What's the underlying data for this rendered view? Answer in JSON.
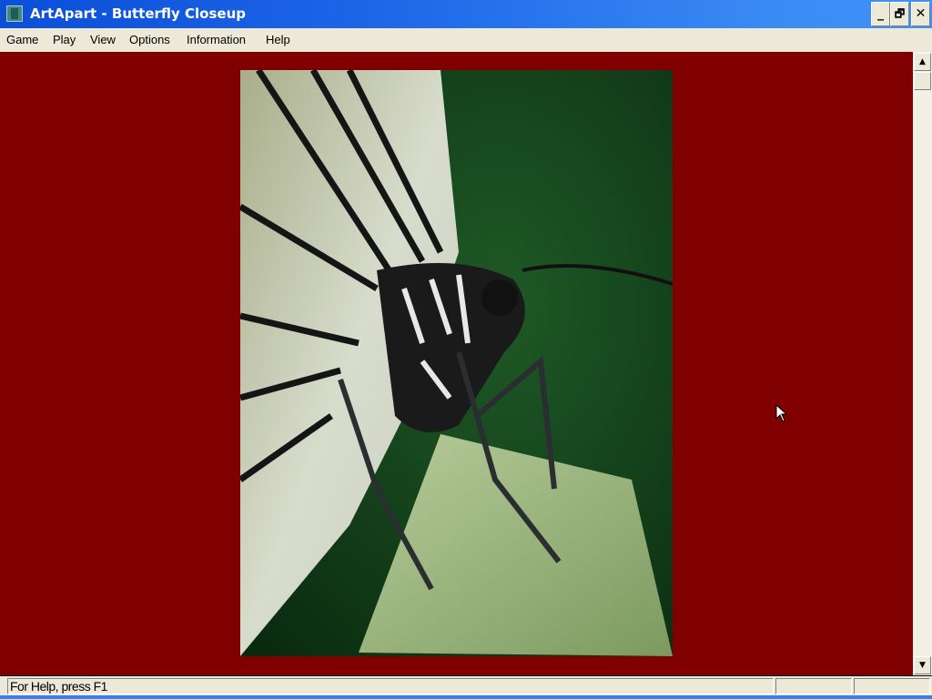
{
  "window": {
    "title": "ArtApart - Butterfly Closeup",
    "minimize": "_",
    "restore": "🗗",
    "close": "✕"
  },
  "menu": [
    "Game",
    "Play",
    "View",
    "Options",
    "Information",
    "Help"
  ],
  "image": {
    "subject": "Butterfly Closeup"
  },
  "scrollbar": {
    "up": "▲",
    "down": "▼"
  },
  "status": {
    "text": "For Help, press F1",
    "pane2": "",
    "pane3": ""
  },
  "colors": {
    "background": "#800000",
    "titlebar": "#1d66e8"
  }
}
